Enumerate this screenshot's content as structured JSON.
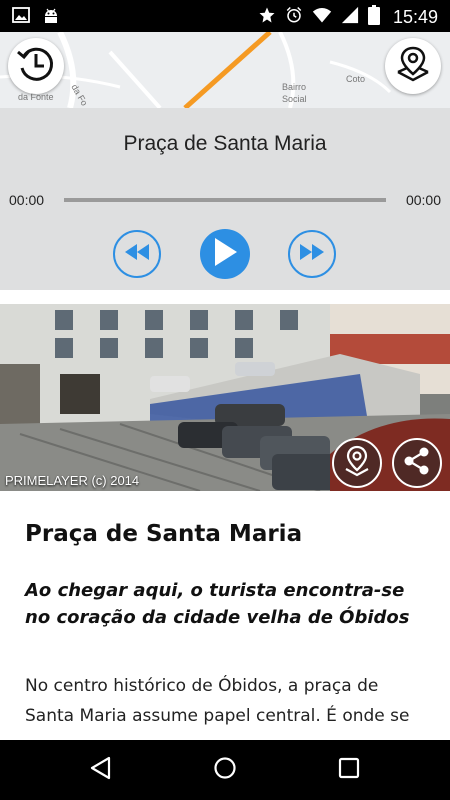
{
  "status_bar": {
    "time": "15:49",
    "left_icons": [
      "image-icon",
      "android-icon"
    ],
    "right_icons": [
      "star-icon",
      "alarm-icon",
      "wifi-icon",
      "signal-icon",
      "battery-icon"
    ]
  },
  "map": {
    "labels": [
      "da Fonte",
      "Coto",
      "Bairro",
      "Social",
      "da Fo"
    ],
    "history_button_icon": "clock-history-icon",
    "locate_button_icon": "map-pin-icon"
  },
  "player": {
    "title": "Praça de Santa Maria",
    "time_elapsed": "00:00",
    "time_total": "00:00",
    "progress": 0,
    "rewind_icon": "rewind-icon",
    "play_icon": "play-icon",
    "forward_icon": "fast-forward-icon"
  },
  "photo": {
    "credit": "PRIMELAYER (c) 2014",
    "pin_button_icon": "location-pin-icon",
    "share_button_icon": "share-icon"
  },
  "article": {
    "title": "Praça de Santa Maria",
    "lead": "Ao chegar aqui, o turista encontra-se no coração da cidade velha de Óbidos",
    "body": "No centro histórico de Óbidos, a praça de Santa Maria assume papel central. É onde se"
  },
  "colors": {
    "accent": "#2d8fe3",
    "player_bg": "#dedfe0",
    "map_road": "#f59a23"
  },
  "nav_bar": {
    "back_icon": "back-triangle-icon",
    "home_icon": "home-circle-icon",
    "recents_icon": "recents-square-icon"
  }
}
